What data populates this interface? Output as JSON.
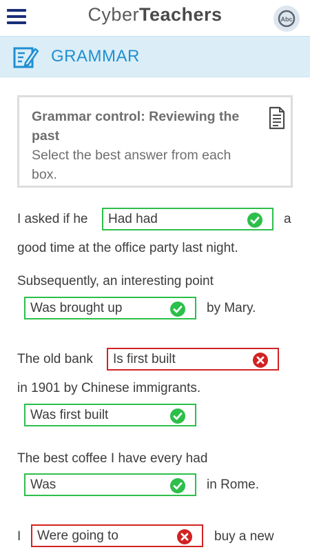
{
  "header": {
    "brand_light": "Cyber",
    "brand_bold": "Teachers",
    "avatar_text": "Abc"
  },
  "section": {
    "title": "GRAMMAR"
  },
  "card": {
    "title": "Grammar control:  Reviewing the past",
    "subtitle": "Select the best answer from each box."
  },
  "exercise": {
    "q1_pre": "I asked if he",
    "q1_answer": "Had had",
    "q1_post_a": "a",
    "q1_post_b": "good time at the office party last night.",
    "q2_pre": "Subsequently, an interesting point",
    "q2_answer": "Was brought up",
    "q2_post": "by Mary.",
    "q3_pre": "The old bank",
    "q3_answer_wrong": "Is first built",
    "q3_post": "in 1901 by Chinese immigrants.",
    "q3_answer_correct": "Was first built",
    "q4_pre": "The best coffee I have every had",
    "q4_answer": "Was",
    "q4_post": "in Rome.",
    "q5_pre": "I",
    "q5_answer": "Were going to",
    "q5_post": "buy a new"
  },
  "colors": {
    "correct": "#2cbf4a",
    "wrong": "#d22222",
    "accent": "#1f8fd1",
    "nav": "#1a2f7a"
  }
}
